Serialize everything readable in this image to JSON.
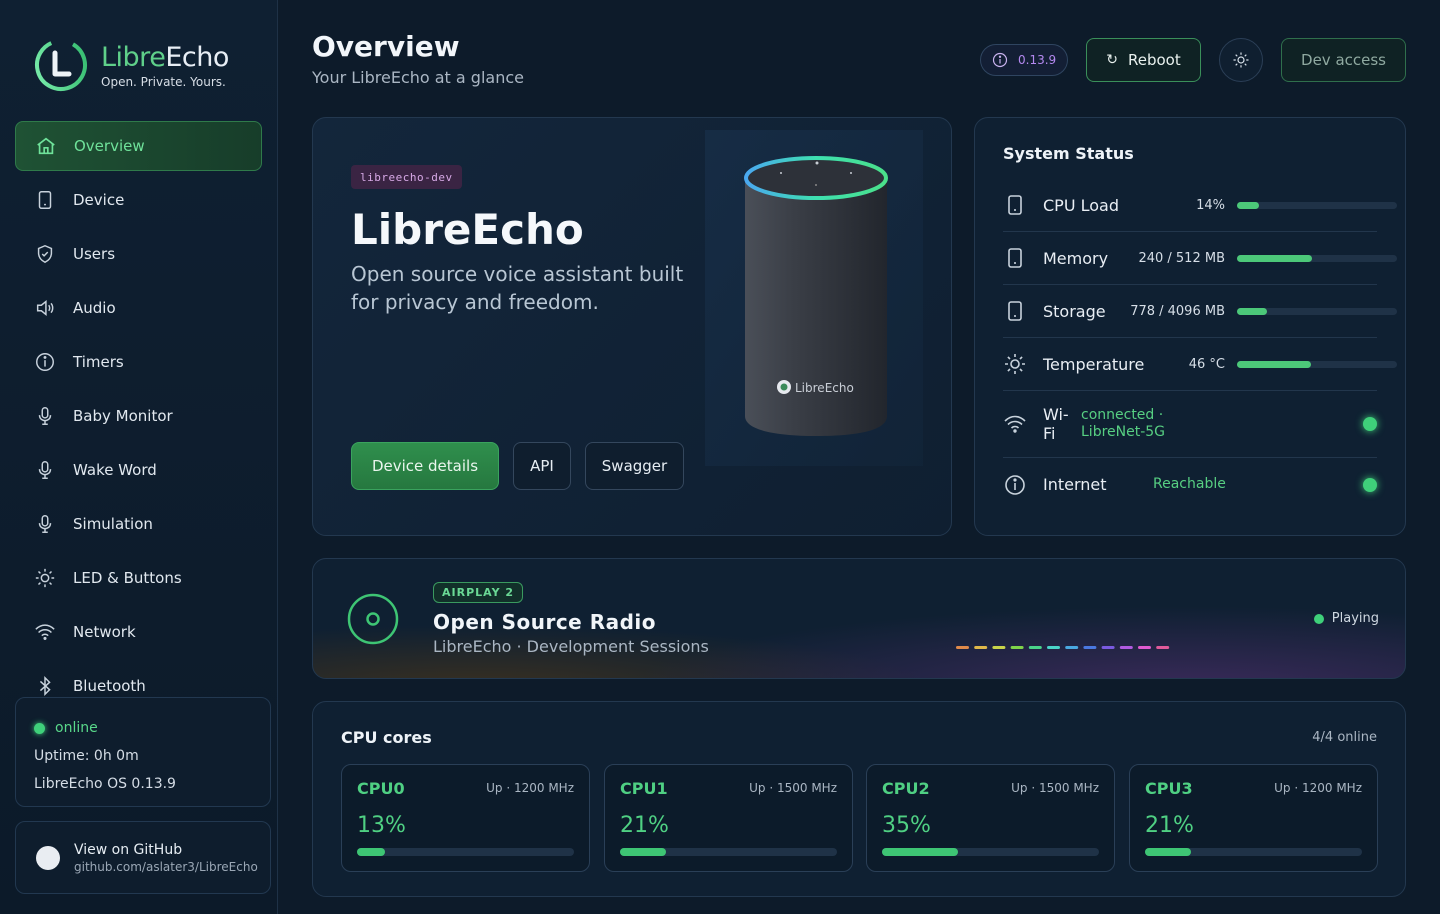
{
  "brand": {
    "name_part1": "Libre",
    "name_part2": "Echo",
    "tagline": "Open. Private. Yours."
  },
  "nav": [
    {
      "label": "Overview",
      "icon": "home-icon",
      "active": true
    },
    {
      "label": "Device",
      "icon": "device-icon"
    },
    {
      "label": "Users",
      "icon": "shield-icon"
    },
    {
      "label": "Audio",
      "icon": "speaker-icon"
    },
    {
      "label": "Timers",
      "icon": "info-icon"
    },
    {
      "label": "Baby Monitor",
      "icon": "mic-icon"
    },
    {
      "label": "Wake Word",
      "icon": "mic-icon"
    },
    {
      "label": "Simulation",
      "icon": "mic-icon"
    },
    {
      "label": "LED & Buttons",
      "icon": "sun-icon"
    },
    {
      "label": "Network",
      "icon": "wifi-icon"
    },
    {
      "label": "Bluetooth",
      "icon": "bluetooth-icon"
    }
  ],
  "status": {
    "online": "online",
    "uptime": "Uptime: 0h 0m",
    "os": "LibreEcho OS 0.13.9"
  },
  "github": {
    "title": "View on GitHub",
    "url": "github.com/aslater3/LibreEcho"
  },
  "header": {
    "title": "Overview",
    "subtitle": "Your LibreEcho at a glance",
    "version": "0.13.9",
    "reboot": "Reboot",
    "dev_access": "Dev access"
  },
  "hero": {
    "badge": "libreecho-dev",
    "title": "LibreEcho",
    "description": "Open source voice assistant built for privacy and freedom.",
    "btn_details": "Device details",
    "btn_api": "API",
    "btn_swagger": "Swagger",
    "speaker_logo": "LibreEcho"
  },
  "system": {
    "title": "System Status",
    "cpu": {
      "label": "CPU Load",
      "value": "14%",
      "fraction": 0.14
    },
    "memory": {
      "label": "Memory",
      "value": "240 / 512 MB",
      "fraction": 0.47
    },
    "storage": {
      "label": "Storage",
      "value": "778 / 4096 MB",
      "fraction": 0.19
    },
    "temperature": {
      "label": "Temperature",
      "value": "46 °C",
      "fraction": 0.46
    },
    "wifi": {
      "label_1": "Wi-",
      "label_2": "Fi",
      "status_1": "connected ·",
      "status_2": "LibreNet-5G"
    },
    "internet": {
      "label": "Internet",
      "status": "Reachable"
    }
  },
  "now_playing": {
    "badge": "AIRPLAY 2",
    "title": "Open Source Radio",
    "subtitle": "LibreEcho · Development Sessions",
    "state": "Playing",
    "eq_colors": [
      "#e08a4a",
      "#e0b84a",
      "#c8d44a",
      "#7fd44a",
      "#4ad48a",
      "#4ad4c8",
      "#4aa8e0",
      "#4a78e0",
      "#7a5ae0",
      "#b05ae0",
      "#e05ad0",
      "#e05a9a"
    ]
  },
  "cpu": {
    "title": "CPU cores",
    "count": "4/4 online",
    "cores": [
      {
        "name": "CPU0",
        "info": "Up · 1200 MHz",
        "pct": "13%",
        "fraction": 0.13
      },
      {
        "name": "CPU1",
        "info": "Up · 1500 MHz",
        "pct": "21%",
        "fraction": 0.21
      },
      {
        "name": "CPU2",
        "info": "Up · 1500 MHz",
        "pct": "35%",
        "fraction": 0.35
      },
      {
        "name": "CPU3",
        "info": "Up · 1200 MHz",
        "pct": "21%",
        "fraction": 0.21
      }
    ]
  },
  "colors": {
    "accent": "#4cc879",
    "background": "#0d1b2a",
    "card": "#0f2032"
  }
}
